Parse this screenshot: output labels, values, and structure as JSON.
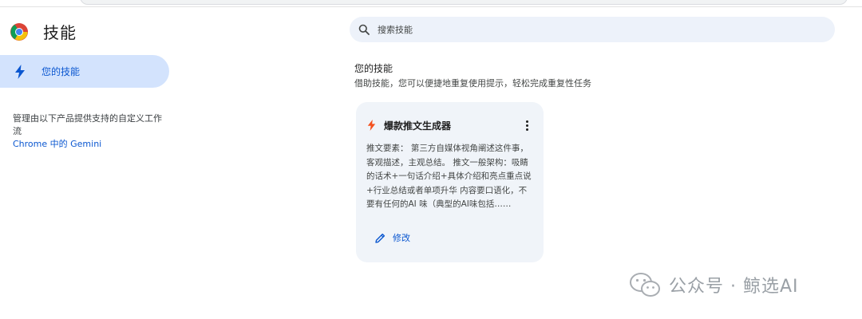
{
  "sidebar": {
    "title": "技能",
    "nav": {
      "label": "您的技能",
      "icon": "bolt-icon"
    },
    "manage_text_prefix": "管理由以下产品提供支持的自定义工作流",
    "manage_link": "Chrome 中的 Gemini"
  },
  "search": {
    "placeholder": "搜索技能",
    "value": ""
  },
  "section": {
    "title": "您的技能",
    "description": "借助技能，您可以便捷地重复使用提示，轻松完成重复性任务"
  },
  "card": {
    "title": "爆款推文生成器",
    "body": "推文要素： 第三方自媒体视角阐述这件事，客观描述，主观总结。 推文一般架构：吸睛的话术+一句话介绍+具体介绍和亮点重点说+行业总结或者单项升华 内容要口语化，不要有任何的AI 味（典型的AI味包括……",
    "edit_label": "修改",
    "icon": "bolt-orange-icon",
    "more_icon": "more-vert-icon"
  },
  "watermark": {
    "text": "公众号 · 鲸选AI"
  },
  "colors": {
    "accent": "#0b57d0",
    "nav_active_bg": "#d3e3fd",
    "card_bg": "#f0f4f9",
    "search_bg": "#edf2fa",
    "skill_icon": "#f4511e"
  }
}
